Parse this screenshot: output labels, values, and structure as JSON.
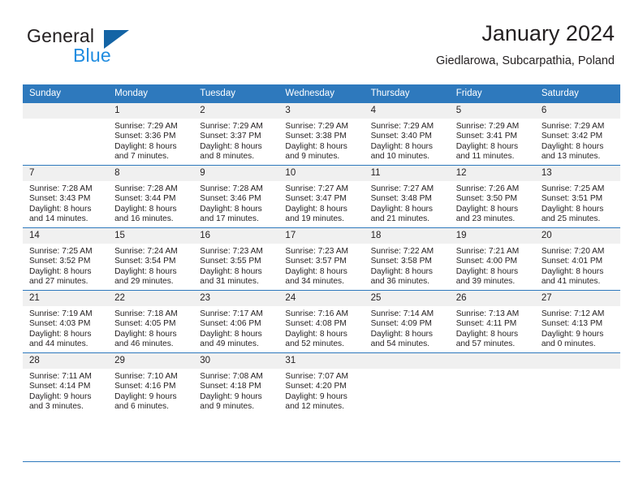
{
  "brand": {
    "name_part1": "General",
    "name_part2": "Blue",
    "triangle_color": "#1464a5",
    "blue_color": "#1f8ce0"
  },
  "header": {
    "title": "January 2024",
    "subtitle": "Giedlarowa, Subcarpathia, Poland"
  },
  "theme": {
    "header_blue": "#2e79bd",
    "daynum_gray": "#f0f0f0"
  },
  "weekdays": [
    "Sunday",
    "Monday",
    "Tuesday",
    "Wednesday",
    "Thursday",
    "Friday",
    "Saturday"
  ],
  "weeks": [
    [
      {
        "day": "",
        "lines": []
      },
      {
        "day": "1",
        "lines": [
          "Sunrise: 7:29 AM",
          "Sunset: 3:36 PM",
          "Daylight: 8 hours",
          "and 7 minutes."
        ]
      },
      {
        "day": "2",
        "lines": [
          "Sunrise: 7:29 AM",
          "Sunset: 3:37 PM",
          "Daylight: 8 hours",
          "and 8 minutes."
        ]
      },
      {
        "day": "3",
        "lines": [
          "Sunrise: 7:29 AM",
          "Sunset: 3:38 PM",
          "Daylight: 8 hours",
          "and 9 minutes."
        ]
      },
      {
        "day": "4",
        "lines": [
          "Sunrise: 7:29 AM",
          "Sunset: 3:40 PM",
          "Daylight: 8 hours",
          "and 10 minutes."
        ]
      },
      {
        "day": "5",
        "lines": [
          "Sunrise: 7:29 AM",
          "Sunset: 3:41 PM",
          "Daylight: 8 hours",
          "and 11 minutes."
        ]
      },
      {
        "day": "6",
        "lines": [
          "Sunrise: 7:29 AM",
          "Sunset: 3:42 PM",
          "Daylight: 8 hours",
          "and 13 minutes."
        ]
      }
    ],
    [
      {
        "day": "7",
        "lines": [
          "Sunrise: 7:28 AM",
          "Sunset: 3:43 PM",
          "Daylight: 8 hours",
          "and 14 minutes."
        ]
      },
      {
        "day": "8",
        "lines": [
          "Sunrise: 7:28 AM",
          "Sunset: 3:44 PM",
          "Daylight: 8 hours",
          "and 16 minutes."
        ]
      },
      {
        "day": "9",
        "lines": [
          "Sunrise: 7:28 AM",
          "Sunset: 3:46 PM",
          "Daylight: 8 hours",
          "and 17 minutes."
        ]
      },
      {
        "day": "10",
        "lines": [
          "Sunrise: 7:27 AM",
          "Sunset: 3:47 PM",
          "Daylight: 8 hours",
          "and 19 minutes."
        ]
      },
      {
        "day": "11",
        "lines": [
          "Sunrise: 7:27 AM",
          "Sunset: 3:48 PM",
          "Daylight: 8 hours",
          "and 21 minutes."
        ]
      },
      {
        "day": "12",
        "lines": [
          "Sunrise: 7:26 AM",
          "Sunset: 3:50 PM",
          "Daylight: 8 hours",
          "and 23 minutes."
        ]
      },
      {
        "day": "13",
        "lines": [
          "Sunrise: 7:25 AM",
          "Sunset: 3:51 PM",
          "Daylight: 8 hours",
          "and 25 minutes."
        ]
      }
    ],
    [
      {
        "day": "14",
        "lines": [
          "Sunrise: 7:25 AM",
          "Sunset: 3:52 PM",
          "Daylight: 8 hours",
          "and 27 minutes."
        ]
      },
      {
        "day": "15",
        "lines": [
          "Sunrise: 7:24 AM",
          "Sunset: 3:54 PM",
          "Daylight: 8 hours",
          "and 29 minutes."
        ]
      },
      {
        "day": "16",
        "lines": [
          "Sunrise: 7:23 AM",
          "Sunset: 3:55 PM",
          "Daylight: 8 hours",
          "and 31 minutes."
        ]
      },
      {
        "day": "17",
        "lines": [
          "Sunrise: 7:23 AM",
          "Sunset: 3:57 PM",
          "Daylight: 8 hours",
          "and 34 minutes."
        ]
      },
      {
        "day": "18",
        "lines": [
          "Sunrise: 7:22 AM",
          "Sunset: 3:58 PM",
          "Daylight: 8 hours",
          "and 36 minutes."
        ]
      },
      {
        "day": "19",
        "lines": [
          "Sunrise: 7:21 AM",
          "Sunset: 4:00 PM",
          "Daylight: 8 hours",
          "and 39 minutes."
        ]
      },
      {
        "day": "20",
        "lines": [
          "Sunrise: 7:20 AM",
          "Sunset: 4:01 PM",
          "Daylight: 8 hours",
          "and 41 minutes."
        ]
      }
    ],
    [
      {
        "day": "21",
        "lines": [
          "Sunrise: 7:19 AM",
          "Sunset: 4:03 PM",
          "Daylight: 8 hours",
          "and 44 minutes."
        ]
      },
      {
        "day": "22",
        "lines": [
          "Sunrise: 7:18 AM",
          "Sunset: 4:05 PM",
          "Daylight: 8 hours",
          "and 46 minutes."
        ]
      },
      {
        "day": "23",
        "lines": [
          "Sunrise: 7:17 AM",
          "Sunset: 4:06 PM",
          "Daylight: 8 hours",
          "and 49 minutes."
        ]
      },
      {
        "day": "24",
        "lines": [
          "Sunrise: 7:16 AM",
          "Sunset: 4:08 PM",
          "Daylight: 8 hours",
          "and 52 minutes."
        ]
      },
      {
        "day": "25",
        "lines": [
          "Sunrise: 7:14 AM",
          "Sunset: 4:09 PM",
          "Daylight: 8 hours",
          "and 54 minutes."
        ]
      },
      {
        "day": "26",
        "lines": [
          "Sunrise: 7:13 AM",
          "Sunset: 4:11 PM",
          "Daylight: 8 hours",
          "and 57 minutes."
        ]
      },
      {
        "day": "27",
        "lines": [
          "Sunrise: 7:12 AM",
          "Sunset: 4:13 PM",
          "Daylight: 9 hours",
          "and 0 minutes."
        ]
      }
    ],
    [
      {
        "day": "28",
        "lines": [
          "Sunrise: 7:11 AM",
          "Sunset: 4:14 PM",
          "Daylight: 9 hours",
          "and 3 minutes."
        ]
      },
      {
        "day": "29",
        "lines": [
          "Sunrise: 7:10 AM",
          "Sunset: 4:16 PM",
          "Daylight: 9 hours",
          "and 6 minutes."
        ]
      },
      {
        "day": "30",
        "lines": [
          "Sunrise: 7:08 AM",
          "Sunset: 4:18 PM",
          "Daylight: 9 hours",
          "and 9 minutes."
        ]
      },
      {
        "day": "31",
        "lines": [
          "Sunrise: 7:07 AM",
          "Sunset: 4:20 PM",
          "Daylight: 9 hours",
          "and 12 minutes."
        ]
      },
      {
        "day": "",
        "lines": []
      },
      {
        "day": "",
        "lines": []
      },
      {
        "day": "",
        "lines": []
      }
    ]
  ]
}
